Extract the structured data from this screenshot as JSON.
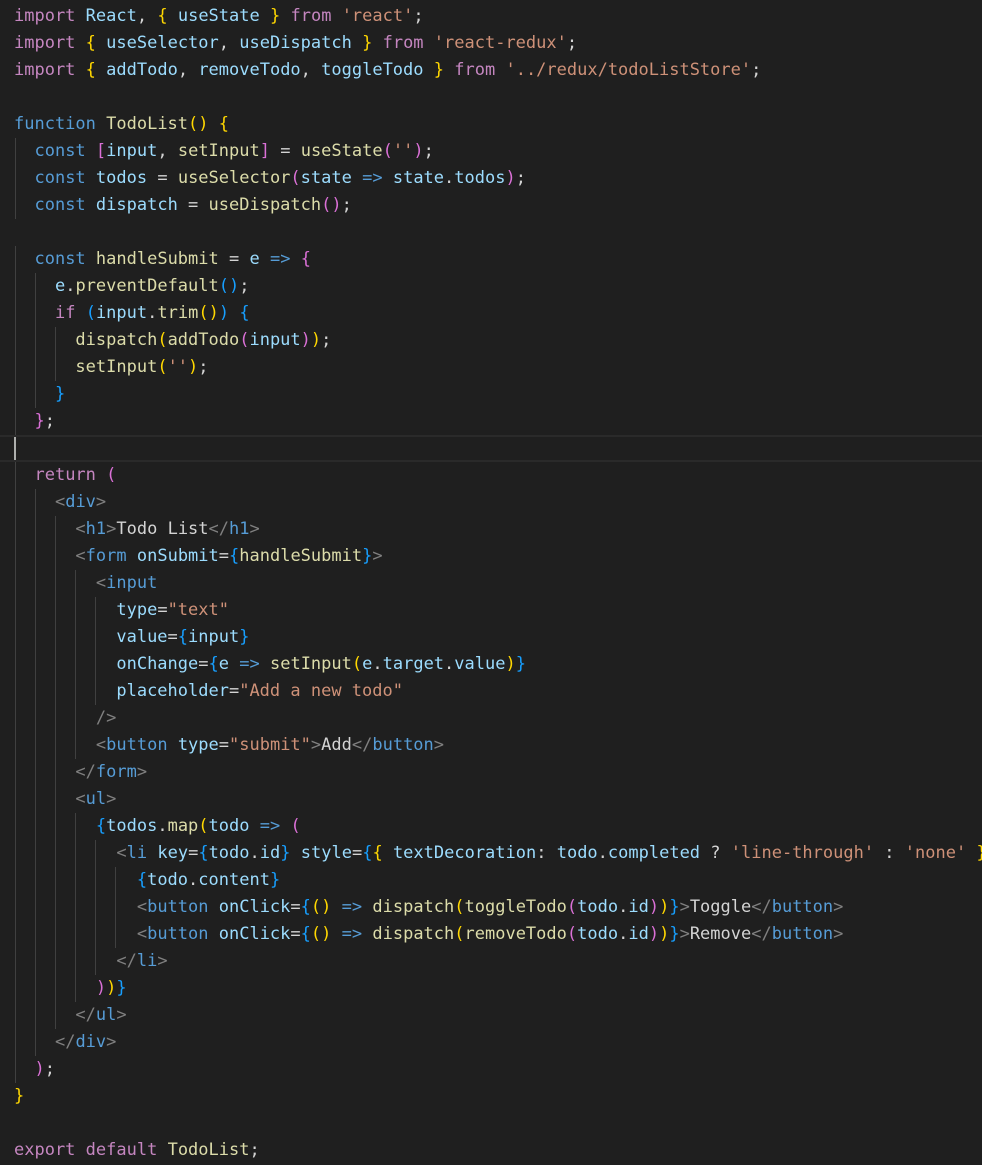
{
  "code": {
    "language": "javascript",
    "lines": [
      [
        [
          "kw",
          "import"
        ],
        [
          "pn",
          " "
        ],
        [
          "vr",
          "React"
        ],
        [
          "pn",
          ", "
        ],
        [
          "b1",
          "{"
        ],
        [
          "pn",
          " "
        ],
        [
          "vr",
          "useState"
        ],
        [
          "pn",
          " "
        ],
        [
          "b1",
          "}"
        ],
        [
          "pn",
          " "
        ],
        [
          "kw",
          "from"
        ],
        [
          "pn",
          " "
        ],
        [
          "str",
          "'react'"
        ],
        [
          "pn",
          ";"
        ]
      ],
      [
        [
          "kw",
          "import"
        ],
        [
          "pn",
          " "
        ],
        [
          "b1",
          "{"
        ],
        [
          "pn",
          " "
        ],
        [
          "vr",
          "useSelector"
        ],
        [
          "pn",
          ", "
        ],
        [
          "vr",
          "useDispatch"
        ],
        [
          "pn",
          " "
        ],
        [
          "b1",
          "}"
        ],
        [
          "pn",
          " "
        ],
        [
          "kw",
          "from"
        ],
        [
          "pn",
          " "
        ],
        [
          "str",
          "'react-redux'"
        ],
        [
          "pn",
          ";"
        ]
      ],
      [
        [
          "kw",
          "import"
        ],
        [
          "pn",
          " "
        ],
        [
          "b1",
          "{"
        ],
        [
          "pn",
          " "
        ],
        [
          "vr",
          "addTodo"
        ],
        [
          "pn",
          ", "
        ],
        [
          "vr",
          "removeTodo"
        ],
        [
          "pn",
          ", "
        ],
        [
          "vr",
          "toggleTodo"
        ],
        [
          "pn",
          " "
        ],
        [
          "b1",
          "}"
        ],
        [
          "pn",
          " "
        ],
        [
          "kw",
          "from"
        ],
        [
          "pn",
          " "
        ],
        [
          "str",
          "'../redux/todoListStore'"
        ],
        [
          "pn",
          ";"
        ]
      ],
      [],
      [
        [
          "st",
          "function"
        ],
        [
          "pn",
          " "
        ],
        [
          "fn",
          "TodoList"
        ],
        [
          "b1",
          "()"
        ],
        [
          "pn",
          " "
        ],
        [
          "b1",
          "{"
        ]
      ],
      [
        [
          "pn",
          "  "
        ],
        [
          "st",
          "const"
        ],
        [
          "pn",
          " "
        ],
        [
          "b2",
          "["
        ],
        [
          "vr",
          "input"
        ],
        [
          "pn",
          ", "
        ],
        [
          "fn",
          "setInput"
        ],
        [
          "b2",
          "]"
        ],
        [
          "pn",
          " = "
        ],
        [
          "fn",
          "useState"
        ],
        [
          "b2",
          "("
        ],
        [
          "str",
          "''"
        ],
        [
          "b2",
          ")"
        ],
        [
          "pn",
          ";"
        ]
      ],
      [
        [
          "pn",
          "  "
        ],
        [
          "st",
          "const"
        ],
        [
          "pn",
          " "
        ],
        [
          "vr",
          "todos"
        ],
        [
          "pn",
          " = "
        ],
        [
          "fn",
          "useSelector"
        ],
        [
          "b2",
          "("
        ],
        [
          "vr",
          "state"
        ],
        [
          "pn",
          " "
        ],
        [
          "st",
          "=>"
        ],
        [
          "pn",
          " "
        ],
        [
          "vr",
          "state"
        ],
        [
          "pn",
          "."
        ],
        [
          "vr",
          "todos"
        ],
        [
          "b2",
          ")"
        ],
        [
          "pn",
          ";"
        ]
      ],
      [
        [
          "pn",
          "  "
        ],
        [
          "st",
          "const"
        ],
        [
          "pn",
          " "
        ],
        [
          "vr",
          "dispatch"
        ],
        [
          "pn",
          " = "
        ],
        [
          "fn",
          "useDispatch"
        ],
        [
          "b2",
          "()"
        ],
        [
          "pn",
          ";"
        ]
      ],
      [],
      [
        [
          "pn",
          "  "
        ],
        [
          "st",
          "const"
        ],
        [
          "pn",
          " "
        ],
        [
          "fn",
          "handleSubmit"
        ],
        [
          "pn",
          " = "
        ],
        [
          "vr",
          "e"
        ],
        [
          "pn",
          " "
        ],
        [
          "st",
          "=>"
        ],
        [
          "pn",
          " "
        ],
        [
          "b2",
          "{"
        ]
      ],
      [
        [
          "pn",
          "    "
        ],
        [
          "vr",
          "e"
        ],
        [
          "pn",
          "."
        ],
        [
          "fn",
          "preventDefault"
        ],
        [
          "b3",
          "()"
        ],
        [
          "pn",
          ";"
        ]
      ],
      [
        [
          "pn",
          "    "
        ],
        [
          "kw",
          "if"
        ],
        [
          "pn",
          " "
        ],
        [
          "b3",
          "("
        ],
        [
          "vr",
          "input"
        ],
        [
          "pn",
          "."
        ],
        [
          "fn",
          "trim"
        ],
        [
          "b1",
          "()"
        ],
        [
          "b3",
          ")"
        ],
        [
          "pn",
          " "
        ],
        [
          "b3",
          "{"
        ]
      ],
      [
        [
          "pn",
          "      "
        ],
        [
          "fn",
          "dispatch"
        ],
        [
          "b1",
          "("
        ],
        [
          "fn",
          "addTodo"
        ],
        [
          "b2",
          "("
        ],
        [
          "vr",
          "input"
        ],
        [
          "b2",
          ")"
        ],
        [
          "b1",
          ")"
        ],
        [
          "pn",
          ";"
        ]
      ],
      [
        [
          "pn",
          "      "
        ],
        [
          "fn",
          "setInput"
        ],
        [
          "b1",
          "("
        ],
        [
          "str",
          "''"
        ],
        [
          "b1",
          ")"
        ],
        [
          "pn",
          ";"
        ]
      ],
      [
        [
          "pn",
          "    "
        ],
        [
          "b3",
          "}"
        ]
      ],
      [
        [
          "pn",
          "  "
        ],
        [
          "b2",
          "}"
        ],
        [
          "pn",
          ";"
        ]
      ],
      [],
      [
        [
          "pn",
          "  "
        ],
        [
          "kw",
          "return"
        ],
        [
          "pn",
          " "
        ],
        [
          "b2",
          "("
        ]
      ],
      [
        [
          "pn",
          "    "
        ],
        [
          "ab",
          "<"
        ],
        [
          "tg",
          "div"
        ],
        [
          "ab",
          ">"
        ]
      ],
      [
        [
          "pn",
          "      "
        ],
        [
          "ab",
          "<"
        ],
        [
          "tg",
          "h1"
        ],
        [
          "ab",
          ">"
        ],
        [
          "pn",
          "Todo List"
        ],
        [
          "ab",
          "</"
        ],
        [
          "tg",
          "h1"
        ],
        [
          "ab",
          ">"
        ]
      ],
      [
        [
          "pn",
          "      "
        ],
        [
          "ab",
          "<"
        ],
        [
          "tg",
          "form"
        ],
        [
          "pn",
          " "
        ],
        [
          "vr",
          "onSubmit"
        ],
        [
          "pn",
          "="
        ],
        [
          "b3",
          "{"
        ],
        [
          "fn",
          "handleSubmit"
        ],
        [
          "b3",
          "}"
        ],
        [
          "ab",
          ">"
        ]
      ],
      [
        [
          "pn",
          "        "
        ],
        [
          "ab",
          "<"
        ],
        [
          "tg",
          "input"
        ]
      ],
      [
        [
          "pn",
          "          "
        ],
        [
          "vr",
          "type"
        ],
        [
          "pn",
          "="
        ],
        [
          "str",
          "\"text\""
        ]
      ],
      [
        [
          "pn",
          "          "
        ],
        [
          "vr",
          "value"
        ],
        [
          "pn",
          "="
        ],
        [
          "b3",
          "{"
        ],
        [
          "vr",
          "input"
        ],
        [
          "b3",
          "}"
        ]
      ],
      [
        [
          "pn",
          "          "
        ],
        [
          "vr",
          "onChange"
        ],
        [
          "pn",
          "="
        ],
        [
          "b3",
          "{"
        ],
        [
          "vr",
          "e"
        ],
        [
          "pn",
          " "
        ],
        [
          "st",
          "=>"
        ],
        [
          "pn",
          " "
        ],
        [
          "fn",
          "setInput"
        ],
        [
          "b1",
          "("
        ],
        [
          "vr",
          "e"
        ],
        [
          "pn",
          "."
        ],
        [
          "vr",
          "target"
        ],
        [
          "pn",
          "."
        ],
        [
          "vr",
          "value"
        ],
        [
          "b1",
          ")"
        ],
        [
          "b3",
          "}"
        ]
      ],
      [
        [
          "pn",
          "          "
        ],
        [
          "vr",
          "placeholder"
        ],
        [
          "pn",
          "="
        ],
        [
          "str",
          "\"Add a new todo\""
        ]
      ],
      [
        [
          "pn",
          "        "
        ],
        [
          "ab",
          "/>"
        ]
      ],
      [
        [
          "pn",
          "        "
        ],
        [
          "ab",
          "<"
        ],
        [
          "tg",
          "button"
        ],
        [
          "pn",
          " "
        ],
        [
          "vr",
          "type"
        ],
        [
          "pn",
          "="
        ],
        [
          "str",
          "\"submit\""
        ],
        [
          "ab",
          ">"
        ],
        [
          "pn",
          "Add"
        ],
        [
          "ab",
          "</"
        ],
        [
          "tg",
          "button"
        ],
        [
          "ab",
          ">"
        ]
      ],
      [
        [
          "pn",
          "      "
        ],
        [
          "ab",
          "</"
        ],
        [
          "tg",
          "form"
        ],
        [
          "ab",
          ">"
        ]
      ],
      [
        [
          "pn",
          "      "
        ],
        [
          "ab",
          "<"
        ],
        [
          "tg",
          "ul"
        ],
        [
          "ab",
          ">"
        ]
      ],
      [
        [
          "pn",
          "        "
        ],
        [
          "b3",
          "{"
        ],
        [
          "vr",
          "todos"
        ],
        [
          "pn",
          "."
        ],
        [
          "fn",
          "map"
        ],
        [
          "b1",
          "("
        ],
        [
          "vr",
          "todo"
        ],
        [
          "pn",
          " "
        ],
        [
          "st",
          "=>"
        ],
        [
          "pn",
          " "
        ],
        [
          "b2",
          "("
        ]
      ],
      [
        [
          "pn",
          "          "
        ],
        [
          "ab",
          "<"
        ],
        [
          "tg",
          "li"
        ],
        [
          "pn",
          " "
        ],
        [
          "vr",
          "key"
        ],
        [
          "pn",
          "="
        ],
        [
          "b3",
          "{"
        ],
        [
          "vr",
          "todo"
        ],
        [
          "pn",
          "."
        ],
        [
          "vr",
          "id"
        ],
        [
          "b3",
          "}"
        ],
        [
          "pn",
          " "
        ],
        [
          "vr",
          "style"
        ],
        [
          "pn",
          "="
        ],
        [
          "b3",
          "{"
        ],
        [
          "b1",
          "{"
        ],
        [
          "pn",
          " "
        ],
        [
          "vr",
          "textDecoration"
        ],
        [
          "pn",
          ": "
        ],
        [
          "vr",
          "todo"
        ],
        [
          "pn",
          "."
        ],
        [
          "vr",
          "completed"
        ],
        [
          "pn",
          " ? "
        ],
        [
          "str",
          "'line-through'"
        ],
        [
          "pn",
          " : "
        ],
        [
          "str",
          "'none'"
        ],
        [
          "pn",
          " "
        ],
        [
          "b1",
          "}"
        ],
        [
          "b3",
          "}"
        ],
        [
          "ab",
          ">"
        ]
      ],
      [
        [
          "pn",
          "            "
        ],
        [
          "b3",
          "{"
        ],
        [
          "vr",
          "todo"
        ],
        [
          "pn",
          "."
        ],
        [
          "vr",
          "content"
        ],
        [
          "b3",
          "}"
        ]
      ],
      [
        [
          "pn",
          "            "
        ],
        [
          "ab",
          "<"
        ],
        [
          "tg",
          "button"
        ],
        [
          "pn",
          " "
        ],
        [
          "vr",
          "onClick"
        ],
        [
          "pn",
          "="
        ],
        [
          "b3",
          "{"
        ],
        [
          "b1",
          "()"
        ],
        [
          "pn",
          " "
        ],
        [
          "st",
          "=>"
        ],
        [
          "pn",
          " "
        ],
        [
          "fn",
          "dispatch"
        ],
        [
          "b1",
          "("
        ],
        [
          "fn",
          "toggleTodo"
        ],
        [
          "b2",
          "("
        ],
        [
          "vr",
          "todo"
        ],
        [
          "pn",
          "."
        ],
        [
          "vr",
          "id"
        ],
        [
          "b2",
          ")"
        ],
        [
          "b1",
          ")"
        ],
        [
          "b3",
          "}"
        ],
        [
          "ab",
          ">"
        ],
        [
          "pn",
          "Toggle"
        ],
        [
          "ab",
          "</"
        ],
        [
          "tg",
          "button"
        ],
        [
          "ab",
          ">"
        ]
      ],
      [
        [
          "pn",
          "            "
        ],
        [
          "ab",
          "<"
        ],
        [
          "tg",
          "button"
        ],
        [
          "pn",
          " "
        ],
        [
          "vr",
          "onClick"
        ],
        [
          "pn",
          "="
        ],
        [
          "b3",
          "{"
        ],
        [
          "b1",
          "()"
        ],
        [
          "pn",
          " "
        ],
        [
          "st",
          "=>"
        ],
        [
          "pn",
          " "
        ],
        [
          "fn",
          "dispatch"
        ],
        [
          "b1",
          "("
        ],
        [
          "fn",
          "removeTodo"
        ],
        [
          "b2",
          "("
        ],
        [
          "vr",
          "todo"
        ],
        [
          "pn",
          "."
        ],
        [
          "vr",
          "id"
        ],
        [
          "b2",
          ")"
        ],
        [
          "b1",
          ")"
        ],
        [
          "b3",
          "}"
        ],
        [
          "ab",
          ">"
        ],
        [
          "pn",
          "Remove"
        ],
        [
          "ab",
          "</"
        ],
        [
          "tg",
          "button"
        ],
        [
          "ab",
          ">"
        ]
      ],
      [
        [
          "pn",
          "          "
        ],
        [
          "ab",
          "</"
        ],
        [
          "tg",
          "li"
        ],
        [
          "ab",
          ">"
        ]
      ],
      [
        [
          "pn",
          "        "
        ],
        [
          "b2",
          ")"
        ],
        [
          "b1",
          ")"
        ],
        [
          "b3",
          "}"
        ]
      ],
      [
        [
          "pn",
          "      "
        ],
        [
          "ab",
          "</"
        ],
        [
          "tg",
          "ul"
        ],
        [
          "ab",
          ">"
        ]
      ],
      [
        [
          "pn",
          "    "
        ],
        [
          "ab",
          "</"
        ],
        [
          "tg",
          "div"
        ],
        [
          "ab",
          ">"
        ]
      ],
      [
        [
          "pn",
          "  "
        ],
        [
          "b2",
          ")"
        ],
        [
          "pn",
          ";"
        ]
      ],
      [
        [
          "b1",
          "}"
        ]
      ],
      [],
      [
        [
          "kw",
          "export"
        ],
        [
          "pn",
          " "
        ],
        [
          "kw",
          "default"
        ],
        [
          "pn",
          " "
        ],
        [
          "fn",
          "TodoList"
        ],
        [
          "pn",
          ";"
        ]
      ]
    ]
  },
  "colors": {
    "background": "#1f1f1f",
    "keyword": "#c586c0",
    "storage": "#569cd6",
    "function": "#dcdcaa",
    "variable": "#9cdcfe",
    "string": "#ce9178",
    "bracket_gold": "#ffd700",
    "bracket_orchid": "#da70d6",
    "bracket_blue": "#179fff"
  }
}
